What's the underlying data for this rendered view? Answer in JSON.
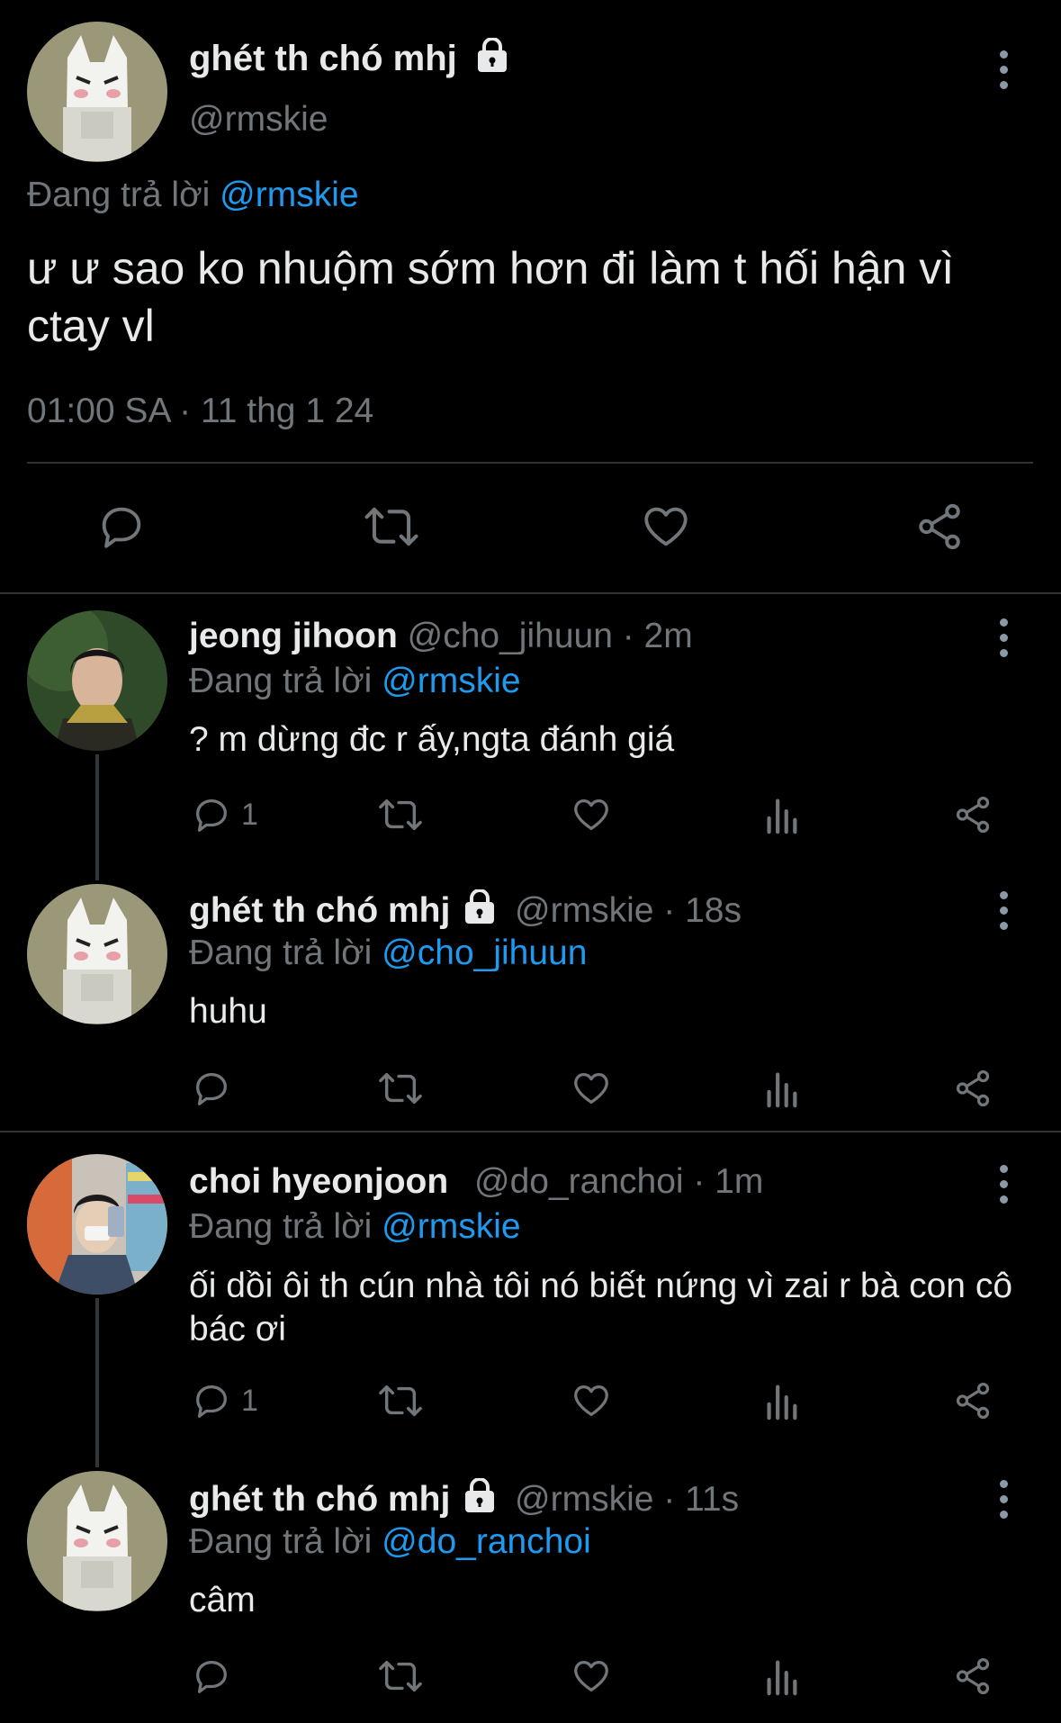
{
  "main_tweet": {
    "display_name": "ghét th chó mhj",
    "handle": "@rmskie",
    "replying_label": "Đang trả lời",
    "replying_to": "@rmskie",
    "text": "ư ư sao ko nhuộm sớm hơn đi làm t hối hận vì ctay vl",
    "timestamp": "01:00 SA · 11 thg 1 24",
    "actions": [
      "reply-icon",
      "retweet-icon",
      "like-icon",
      "share-icon"
    ]
  },
  "replies": [
    {
      "display_name": "jeong jihoon",
      "meta": "@cho_jihuun · 2m",
      "replying_label": "Đang trả lời",
      "replying_to": "@rmskie",
      "text": "? m dừng đc r ấy,ngta đánh giá",
      "reply_count": "1",
      "locked": false
    },
    {
      "display_name": "ghét th chó mhj",
      "meta": "@rmskie · 18s",
      "replying_label": "Đang trả lời",
      "replying_to": "@cho_jihuun",
      "text": "huhu",
      "reply_count": "",
      "locked": true
    },
    {
      "display_name": "choi hyeonjoon",
      "meta": "@do_ranchoi · 1m",
      "replying_label": "Đang trả lời",
      "replying_to": "@rmskie",
      "text": "ối dồi ôi th cún nhà tôi nó biết nứng vì zai r bà con cô bác ơi",
      "reply_count": "1",
      "locked": false
    },
    {
      "display_name": "ghét th chó mhj",
      "meta": "@rmskie · 11s",
      "replying_label": "Đang trả lời",
      "replying_to": "@do_ranchoi",
      "text": "câm",
      "reply_count": "",
      "locked": true
    }
  ],
  "colors": {
    "background": "#000000",
    "text": "#e7e9ea",
    "secondary": "#71767b",
    "link": "#1d9bf0",
    "divider": "#2f3336"
  }
}
